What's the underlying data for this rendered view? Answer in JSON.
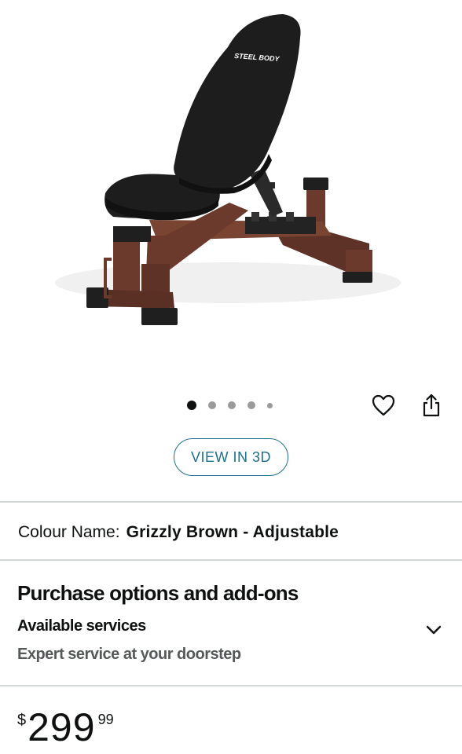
{
  "gallery": {
    "brand_text": "STEEL BODY",
    "dot_count": 5,
    "active_index": 0
  },
  "actions": {
    "wishlist_icon": "heart-icon",
    "share_icon": "share-icon"
  },
  "view3d": {
    "label": "VIEW IN 3D"
  },
  "colour": {
    "label": "Colour Name:",
    "value": "Grizzly Brown - Adjustable"
  },
  "purchase": {
    "title": "Purchase options and add-ons",
    "available_services": "Available services",
    "expert_service": "Expert service at your doorstep",
    "toggle_icon": "chevron-down-icon"
  },
  "price": {
    "symbol": "$",
    "whole": "299",
    "fraction": "99"
  },
  "colors": {
    "link": "#1e6f8f",
    "frame": "#6b3a2c",
    "pad": "#1d1d1d",
    "divider": "#d5d9d9",
    "muted": "#565959"
  }
}
